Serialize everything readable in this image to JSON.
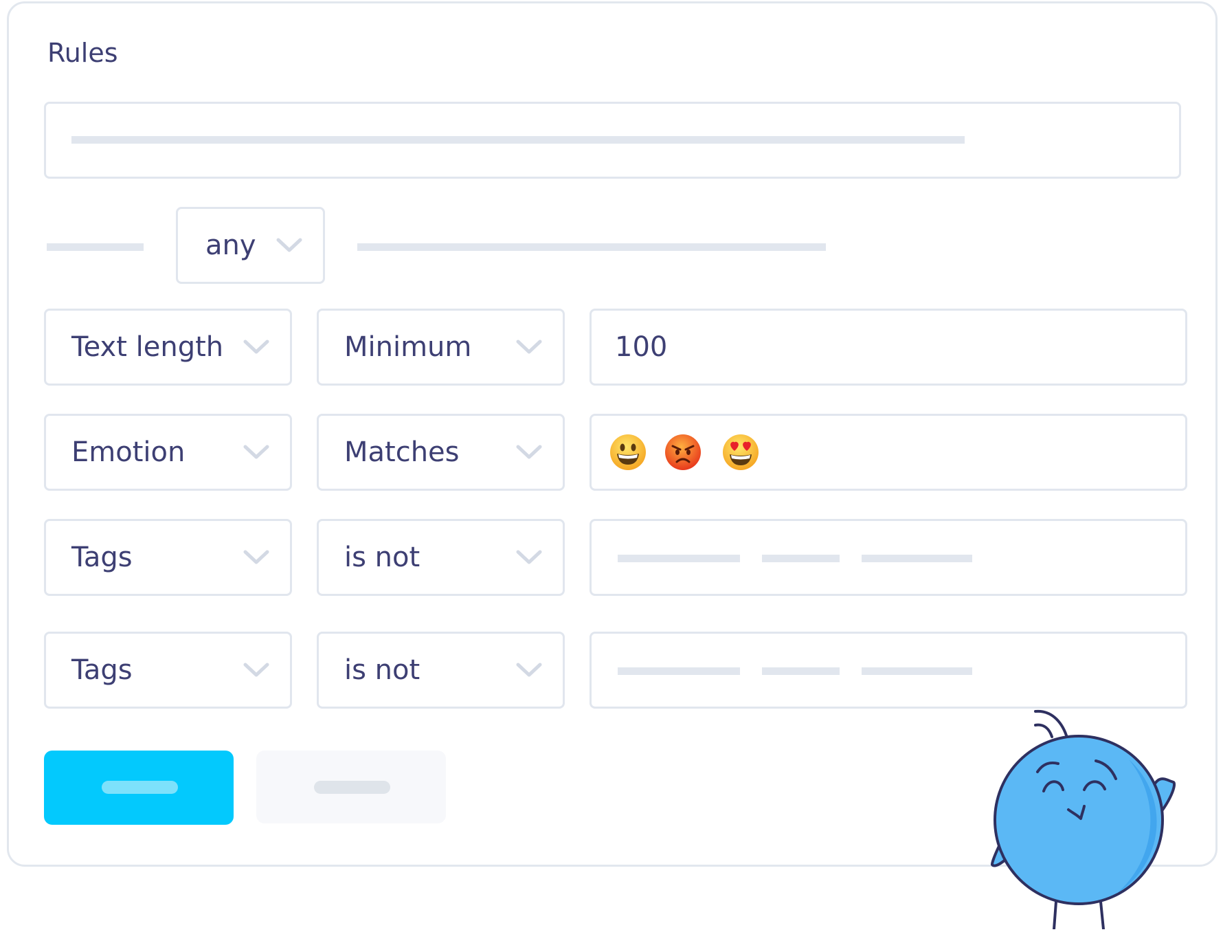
{
  "title": "Rules",
  "match_mode": {
    "value": "any"
  },
  "rules": [
    {
      "field": "Text length",
      "operator": "Minimum",
      "value": "100"
    },
    {
      "field": "Emotion",
      "operator": "Matches",
      "emojis": [
        "grinning-face",
        "pouting-face",
        "heart-eyes-face"
      ]
    },
    {
      "field": "Tags",
      "operator": "is not"
    },
    {
      "field": "Tags",
      "operator": "is not"
    }
  ],
  "colors": {
    "text": "#3d3f73",
    "border": "#e1e6ee",
    "primary": "#03c9fd",
    "mascot": "#5bb8f5"
  }
}
